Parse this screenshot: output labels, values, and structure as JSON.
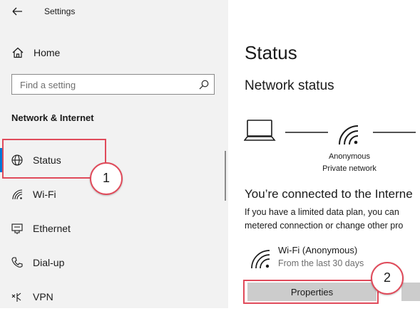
{
  "app": {
    "title": "Settings"
  },
  "sidebar": {
    "home": {
      "label": "Home",
      "icon": "home-icon"
    },
    "search": {
      "placeholder": "Find a setting",
      "icon": "search-icon"
    },
    "section_title": "Network & Internet",
    "items": [
      {
        "label": "Status",
        "icon": "globe-icon",
        "selected": true
      },
      {
        "label": "Wi-Fi",
        "icon": "wifi-icon",
        "selected": false
      },
      {
        "label": "Ethernet",
        "icon": "ethernet-icon",
        "selected": false
      },
      {
        "label": "Dial-up",
        "icon": "phone-icon",
        "selected": false
      },
      {
        "label": "VPN",
        "icon": "vpn-icon",
        "selected": false
      }
    ]
  },
  "main": {
    "title": "Status",
    "network_status_heading": "Network status",
    "network_name": "Anonymous",
    "network_type": "Private network",
    "connected_heading": "You’re connected to the Interne",
    "description_line1": "If you have a limited data plan, you can",
    "description_line2": "metered connection or change other pro",
    "connection": {
      "name": "Wi-Fi (Anonymous)",
      "subtitle": "From the last 30 days"
    },
    "properties_button": "Properties"
  },
  "annotations": {
    "badge1": "1",
    "badge2": "2"
  },
  "colors": {
    "accent": "#0078d7",
    "annotation": "#e04a5a",
    "sidebar_bg": "#f2f2f2"
  }
}
